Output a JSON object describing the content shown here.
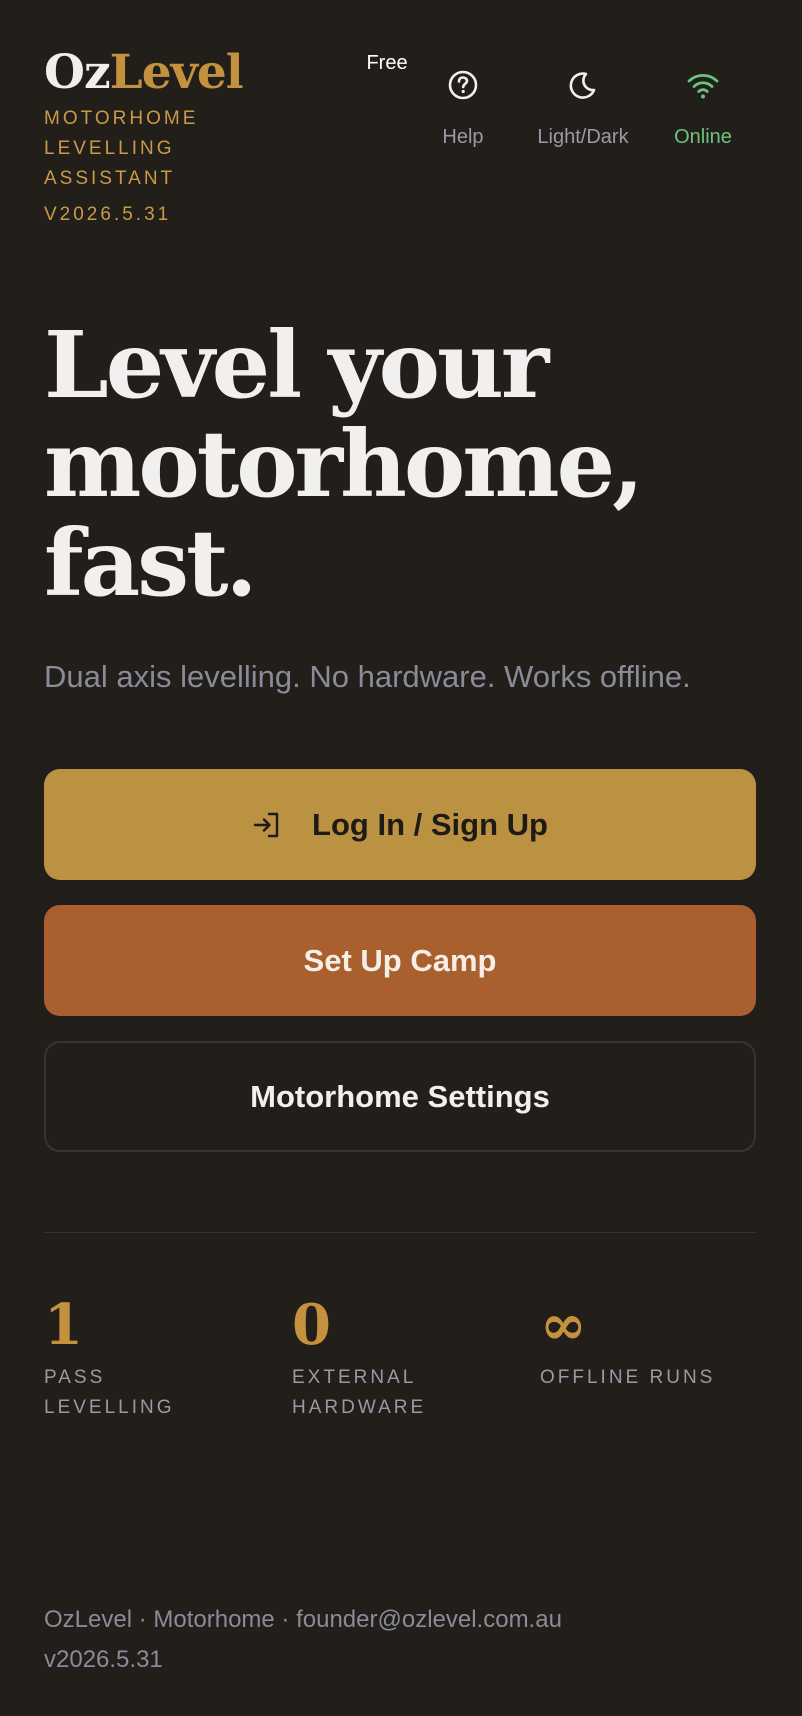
{
  "brand": {
    "logo_part1": "Oz",
    "logo_part2": "Level",
    "tagline": "Motorhome Levelling Assistant",
    "version": "V2026.5.31"
  },
  "header": {
    "plan": "Free",
    "nav": [
      {
        "label": "Help",
        "icon": "help-circle-icon"
      },
      {
        "label": "Light/Dark",
        "icon": "moon-icon"
      },
      {
        "label": "Online",
        "icon": "wifi-icon"
      }
    ]
  },
  "hero": {
    "title": "Level your motorhome, fast.",
    "subtitle": "Dual axis levelling. No hardware. Works offline."
  },
  "actions": {
    "login": "Log In / Sign Up",
    "camp": "Set Up Camp",
    "settings": "Motorhome Settings"
  },
  "stats": [
    {
      "value": "1",
      "label": "Pass levelling"
    },
    {
      "value": "0",
      "label": "External hardware"
    },
    {
      "value": "∞",
      "label": "Offline runs"
    }
  ],
  "footer": {
    "line1": "OzLevel · Motorhome · founder@ozlevel.com.au",
    "line2": "v2026.5.31"
  },
  "colors": {
    "background": "#221e1a",
    "gold": "#c4913f",
    "login_button": "#bb9142",
    "camp_button": "#a95f2e",
    "online": "#6ec27e"
  }
}
